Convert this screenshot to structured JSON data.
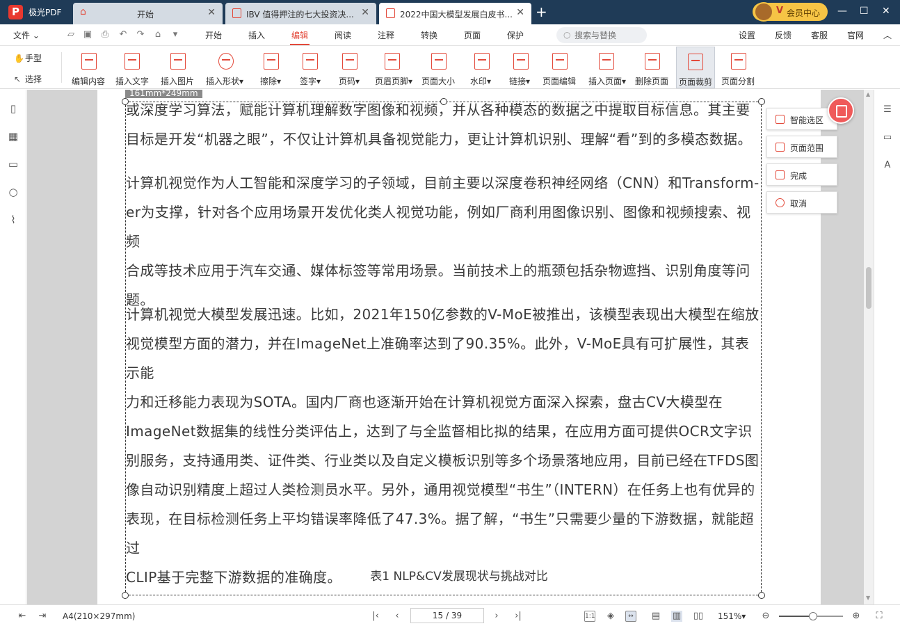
{
  "app": {
    "name": "极光PDF",
    "logo": "P"
  },
  "tabs": [
    {
      "label": "开始",
      "icon": "home-icon"
    },
    {
      "label": "IBV 值得押注的七大投资决...",
      "icon": "pdf-file-icon"
    },
    {
      "label": "2022中国大模型发展白皮书...",
      "icon": "pdf-file-icon"
    }
  ],
  "vip": {
    "badge": "V",
    "label": "会员中心"
  },
  "window": {
    "minimize": "—",
    "maximize": "☐",
    "close": "✕"
  },
  "menubar": {
    "file": "文件",
    "tabs": [
      "开始",
      "插入",
      "编辑",
      "阅读",
      "注释",
      "转换",
      "页面",
      "保护"
    ],
    "active_tab": "编辑",
    "search_placeholder": "搜索与替换",
    "right": [
      "设置",
      "反馈",
      "客服",
      "官网"
    ]
  },
  "toolbar": {
    "modes": [
      "手型",
      "选择"
    ],
    "tools": [
      "编辑内容",
      "插入文字",
      "插入图片",
      "插入形状▾",
      "擦除▾",
      "签字▾",
      "页码▾",
      "页眉页脚▾",
      "页面大小",
      "水印▾",
      "链接▾",
      "页面编辑",
      "插入页面▾",
      "删除页面",
      "页面裁剪",
      "页面分割"
    ],
    "active_tool": "页面裁剪"
  },
  "document": {
    "crop_dimensions": "161mm*249mm",
    "paragraphs": [
      [
        "或深度学习算法，赋能计算机理解数字图像和视频，并从各种模态的数据之中提取目标信息。其主要",
        "目标是开发“机器之眼”，不仅让计算机具备视觉能力，更让计算机识别、理解“看”到的多模态数据。"
      ],
      [
        "计算机视觉作为人工智能和深度学习的子领域，目前主要以深度卷积神经网络（CNN）和Transform-",
        "er为支撑，针对各个应用场景开发优化类人视觉功能，例如厂商利用图像识别、图像和视频搜索、视频",
        "合成等技术应用于汽车交通、媒体标签等常用场景。当前技术上的瓶颈包括杂物遮挡、识别角度等问",
        "题。"
      ],
      [
        "计算机视觉大模型发展迅速。比如，2021年150亿参数的V-MoE被推出，该模型表现出大模型在缩放",
        "视觉模型方面的潜力，并在ImageNet上准确率达到了90.35%。此外，V-MoE具有可扩展性，其表示能",
        "力和迁移能力表现为SOTA。国内厂商也逐渐开始在计算机视觉方面深入探索，盘古CV大模型在",
        "ImageNet数据集的线性分类评估上，达到了与全监督相比拟的结果，在应用方面可提供OCR文字识",
        "别服务，支持通用类、证件类、行业类以及自定义模板识别等多个场景落地应用，目前已经在TFDS图",
        "像自动识别精度上超过人类检测员水平。另外，通用视觉模型“书生”（INTERN）在任务上也有优异的",
        "表现，在目标检测任务上平均错误率降低了47.3%。据了解，“书生”只需要少量的下游数据，就能超过",
        "CLIP基于完整下游数据的准确度。"
      ]
    ],
    "table_caption": "表1 NLP&CV发展现状与挑战对比"
  },
  "crop_panel": {
    "smart_select": "智能选区",
    "page_range": "页面范围",
    "done": "完成",
    "cancel": "取消"
  },
  "statusbar": {
    "page_size": "A4(210×297mm)",
    "current_page": "15",
    "total_pages": "/ 39",
    "page_display": "15 / 39",
    "zoom": "151%▾",
    "zoom_fraction": 0.53
  },
  "colors": {
    "accent": "#e34a3b",
    "titlebar": "#1f3b57"
  }
}
